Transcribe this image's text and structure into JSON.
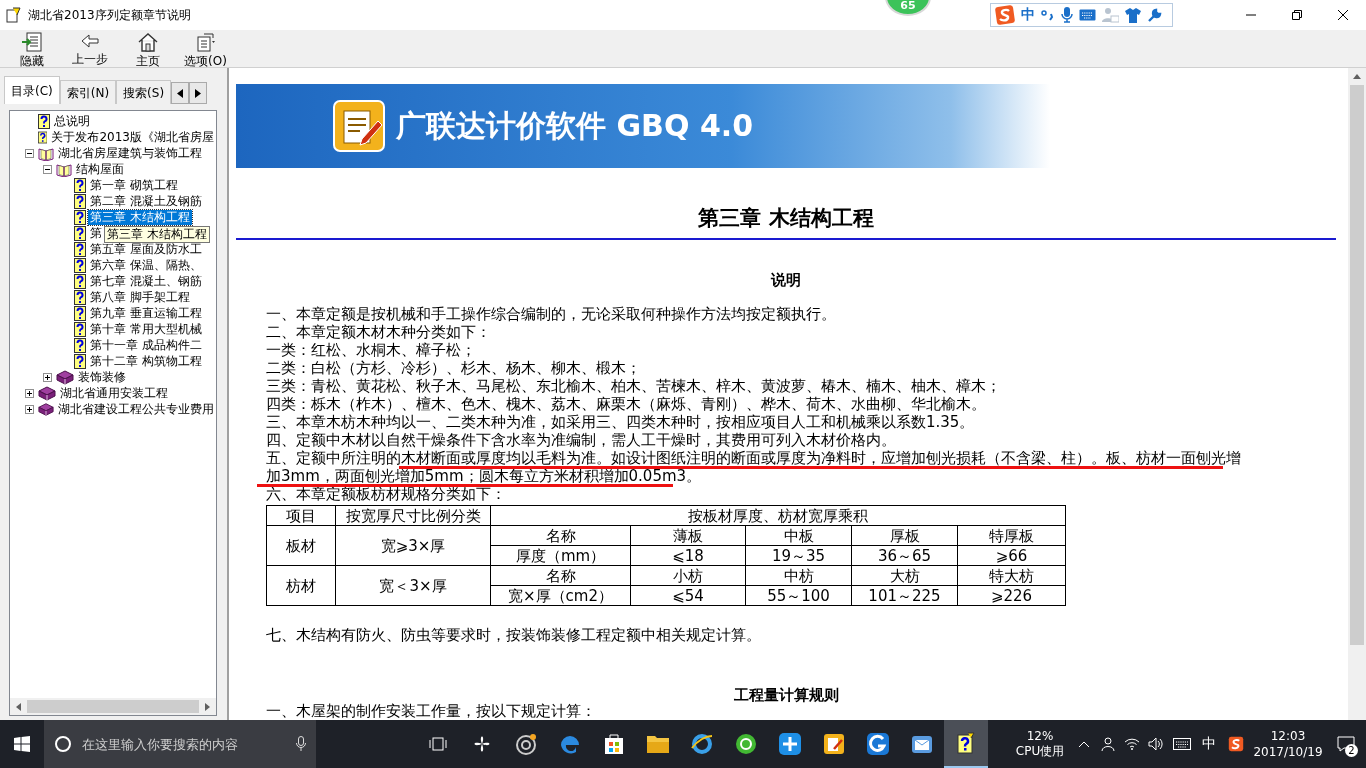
{
  "window": {
    "title": "湖北省2013序列定额章节说明",
    "badge": "65",
    "ime_toolbar": {
      "mode": "中"
    }
  },
  "toolbar": {
    "buttons": [
      {
        "kind": "hide",
        "label": "隐藏"
      },
      {
        "kind": "back",
        "label": "上一步"
      },
      {
        "kind": "home",
        "label": "主页"
      },
      {
        "kind": "options",
        "label": "选项(O)"
      }
    ]
  },
  "tabs": [
    {
      "label": "目录(C)",
      "selected": true
    },
    {
      "label": "索引(N)",
      "selected": false
    },
    {
      "label": "搜索(S)",
      "selected": false
    }
  ],
  "tree": {
    "tooltip": "第三章  木结构工程",
    "items": [
      {
        "kind": "page",
        "label": "总说明",
        "selected": false
      },
      {
        "kind": "page",
        "label": "关于发布2013版《湖北省房屋",
        "selected": false
      },
      {
        "kind": "book",
        "label": "湖北省房屋建筑与装饰工程",
        "expanded": true,
        "children": [
          {
            "kind": "book",
            "label": "结构屋面",
            "expanded": true,
            "children": [
              {
                "kind": "page",
                "label": "第一章  砌筑工程",
                "selected": false
              },
              {
                "kind": "page",
                "label": "第二章  混凝土及钢筋",
                "selected": false
              },
              {
                "kind": "page",
                "label": "第三章  木结构工程",
                "selected": true
              },
              {
                "kind": "page",
                "label": "第",
                "selected": false
              },
              {
                "kind": "page",
                "label": "第五章  屋面及防水工",
                "selected": false
              },
              {
                "kind": "page",
                "label": "第六章  保温、隔热、",
                "selected": false
              },
              {
                "kind": "page",
                "label": "第七章  混凝土、钢筋",
                "selected": false
              },
              {
                "kind": "page",
                "label": "第八章  脚手架工程",
                "selected": false
              },
              {
                "kind": "page",
                "label": "第九章  垂直运输工程",
                "selected": false
              },
              {
                "kind": "page",
                "label": "第十章  常用大型机械",
                "selected": false
              },
              {
                "kind": "page",
                "label": "第十一章  成品构件二",
                "selected": false
              },
              {
                "kind": "page",
                "label": "第十二章  构筑物工程",
                "selected": false
              }
            ]
          },
          {
            "kind": "book",
            "label": "装饰装修",
            "expanded": false
          }
        ]
      },
      {
        "kind": "book",
        "label": "湖北省通用安装工程",
        "expanded": false
      },
      {
        "kind": "book",
        "label": "湖北省建设工程公共专业费用",
        "expanded": false
      }
    ]
  },
  "document": {
    "banner_title": "广联达计价软件 GBQ 4.0",
    "heading": "第三章  木结构工程",
    "section_title": "说明",
    "lines": [
      "一、本章定额是按机械和手工操作综合编制的，无论采取何种操作方法均按定额执行。",
      "二、本章定额木材木种分类如下：",
      "一类：红松、水桐木、樟子松；",
      "二类：白松（方杉、冷杉）、杉木、杨木、柳木、椴木；",
      "三类：青松、黄花松、秋子木、马尾松、东北榆木、柏木、苦楝木、梓木、黄波萝、椿木、楠木、柚木、樟木；",
      "四类：栎木（柞木）、檀木、色木、槐木、荔木、麻栗木（麻烁、青刚）、桦木、荷木、水曲柳、华北榆木。",
      "三、本章木枋木种均以一、二类木种为准，如采用三、四类木种时，按相应项目人工和机械乘以系数1.35。",
      "四、定额中木材以自然干燥条件下含水率为准编制，需人工干燥时，其费用可列入木材价格内。",
      "五、定额中所注明的木材断面或厚度均以毛料为准。如设计图纸注明的断面或厚度为净料时，应增加刨光损耗（不含梁、柱）。板、枋材一面刨光增",
      "加3mm，两面刨光增加5mm；圆木每立方米材积增加0.05m3。",
      "六、本章定额板枋材规格分类如下："
    ],
    "table": {
      "columns": [
        "项目",
        "按宽厚尺寸比例分类",
        "按板材厚度、枋材宽厚乘积"
      ],
      "groups": [
        {
          "item": "板材",
          "ratio": "宽⩾3×厚",
          "rows": [
            [
              "名称",
              "薄板",
              "中板",
              "厚板",
              "特厚板"
            ],
            [
              "厚度（mm）",
              "⩽18",
              "19～35",
              "36～65",
              "⩾66"
            ]
          ]
        },
        {
          "item": "枋材",
          "ratio": "宽＜3×厚",
          "rows": [
            [
              "名称",
              "小枋",
              "中枋",
              "大枋",
              "特大枋"
            ],
            [
              "宽×厚（cm2）",
              "⩽54",
              "55～100",
              "101～225",
              "⩾226"
            ]
          ]
        }
      ]
    },
    "after_table": "七、木结构有防火、防虫等要求时，按装饰装修工程定额中相关规定计算。",
    "rules_title": "工程量计算规则",
    "rules_lines": [
      "一、木屋架的制作安装工作量，按以下规定计算："
    ]
  },
  "taskbar": {
    "search": {
      "placeholder": "在这里输入你要搜索的内容"
    },
    "cpu_value": "12%",
    "cpu_label": "CPU使用",
    "ime": "中",
    "time": "12:03",
    "date": "2017/10/19",
    "notifications": "2"
  }
}
